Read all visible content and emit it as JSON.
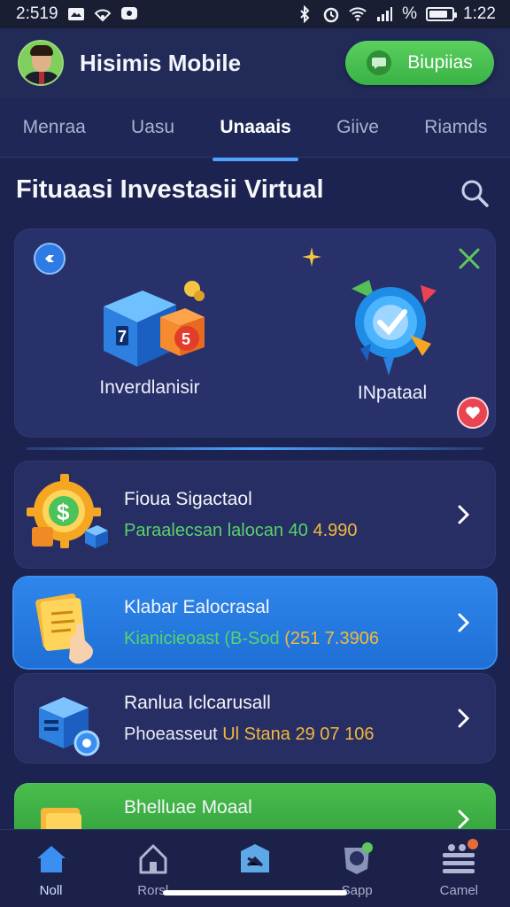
{
  "status_bar": {
    "time_left": "2:519",
    "time_right": "1:22",
    "battery_percent_sign": "%",
    "battery_level": 0.85
  },
  "header": {
    "app_name": "Hisimis Mobile",
    "action_label": "Biupiias"
  },
  "tabs": [
    {
      "label": "Menraa",
      "active": false
    },
    {
      "label": "Uasu",
      "active": false
    },
    {
      "label": "Unaaais",
      "active": true
    },
    {
      "label": "Giive",
      "active": false
    },
    {
      "label": "Riamds",
      "active": false
    }
  ],
  "section": {
    "title": "Fituaasi Investasii Virtual"
  },
  "feature": {
    "item1_label": "Inverdlanisir",
    "item2_label": "INpataal"
  },
  "rows": [
    {
      "title": "Fioua Sigactaol",
      "detail_a": "Paraalecsan lalocan 40",
      "detail_b": "4.990"
    },
    {
      "title": "Klabar Ealocrasal",
      "detail_a": "Kianicieoast (B-Sod",
      "detail_b": "(251 7.3906"
    },
    {
      "title": "Ranlua Iclcarusall",
      "detail_a": "Phoeasseut",
      "detail_b": "Ul Stana 29 07 106"
    },
    {
      "title": "Bhelluae Moaal"
    }
  ],
  "bottom_nav": [
    {
      "label": "Noll",
      "icon": "home-icon",
      "active": true
    },
    {
      "label": "Rorsl",
      "icon": "house-outline-icon",
      "active": false
    },
    {
      "label": "",
      "icon": "chart-box-icon",
      "active": false
    },
    {
      "label": "Sapp",
      "icon": "coin-icon",
      "active": false
    },
    {
      "label": "Camel",
      "icon": "menu-icon",
      "active": false
    }
  ],
  "colors": {
    "background": "#1c2350",
    "accent_blue": "#2f86ea",
    "accent_green": "#4bbd4f",
    "highlight_yellow": "#f5b83a"
  }
}
